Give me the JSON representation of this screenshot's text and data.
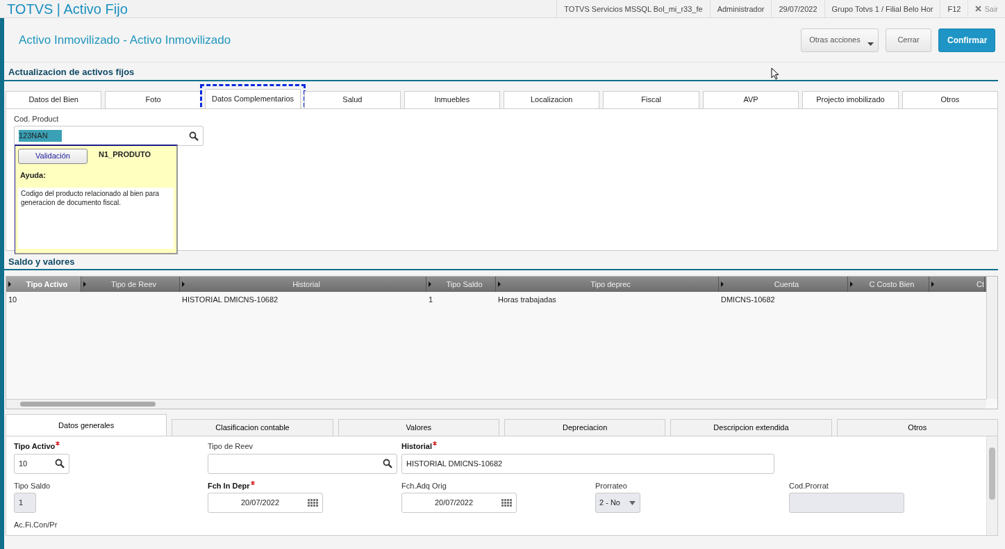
{
  "app_bar": {
    "title": "TOTVS | Activo Fijo",
    "items": [
      "TOTVS Servicios MSSQL Bol_mi_r33_fe",
      "Administrador",
      "29/07/2022",
      "Grupo Totvs 1 / Filial Belo Hor",
      "F12"
    ],
    "exit": "Sair"
  },
  "header": {
    "title": "Activo Inmovilizado - Activo Inmovilizado",
    "buttons": [
      {
        "label": "Otras acciones",
        "kind": "menu"
      },
      {
        "label": "Cerrar",
        "kind": "plain"
      },
      {
        "label": "Confirmar",
        "kind": "primary"
      }
    ]
  },
  "section_title": "Actualizacion de activos fijos",
  "tabs": [
    {
      "label": "Datos del Bien",
      "selected": false
    },
    {
      "label": "Foto",
      "selected": false
    },
    {
      "label": "Datos Complementarios",
      "selected": true
    },
    {
      "label": "Salud",
      "selected": false
    },
    {
      "label": "Inmuebles",
      "selected": false
    },
    {
      "label": "Localizacion",
      "selected": false
    },
    {
      "label": "Fiscal",
      "selected": false
    },
    {
      "label": "AVP",
      "selected": false
    },
    {
      "label": "Projecto imobilizado",
      "selected": false
    },
    {
      "label": "Otros",
      "selected": false
    }
  ],
  "field": {
    "label": "Cod. Product",
    "value": "123NAN"
  },
  "help_popup": {
    "button": "Validación",
    "field_name": "N1_PRODUTO",
    "heading": "Ayuda:",
    "text": "Codigo del producto relacionado al bien para generacion de documento fiscal."
  },
  "section2_title": "Saldo y valores",
  "grid": {
    "columns": [
      {
        "label": "Tipo Activo",
        "selected": true
      },
      {
        "label": "Tipo de Reev",
        "selected": false
      },
      {
        "label": "Historial",
        "selected": false
      },
      {
        "label": "Tipo Saldo",
        "selected": false
      },
      {
        "label": "Tipo deprec",
        "selected": false
      },
      {
        "label": "Cuenta",
        "selected": false
      },
      {
        "label": "C Costo Bien",
        "selected": false
      },
      {
        "label": "Ct",
        "selected": false
      }
    ],
    "rows": [
      {
        "cells": [
          "10",
          null,
          "HISTORIAL DMICNS-10682",
          "1",
          "Horas trabajadas",
          "DMICNS-10682",
          null,
          null
        ]
      }
    ]
  },
  "bottom_tabs": [
    {
      "label": "Datos generales",
      "selected": true
    },
    {
      "label": "Clasificacion contable",
      "selected": false
    },
    {
      "label": "Valores",
      "selected": false
    },
    {
      "label": "Depreciacion",
      "selected": false
    },
    {
      "label": "Descripcion extendida",
      "selected": false
    },
    {
      "label": "Otros",
      "selected": false
    }
  ],
  "form": {
    "rows": [
      [
        {
          "label": "Tipo Activo",
          "required": true,
          "kind": "lookup",
          "value": "10"
        },
        {
          "label": "Tipo de Reev",
          "required": false,
          "kind": "lookup"
        },
        {
          "label": "Historial",
          "required": true,
          "kind": "text",
          "value": "HISTORIAL DMICNS-10682"
        }
      ],
      [
        {
          "label": "Tipo Saldo",
          "required": false,
          "kind": "readonly",
          "value": "1"
        },
        {
          "label": "Fch In Depr",
          "required": true,
          "kind": "date",
          "value": "20/07/2022"
        },
        {
          "label": "Fch.Adq Orig",
          "required": false,
          "kind": "date",
          "value": "20/07/2022"
        },
        {
          "label": "Prorrateo",
          "required": false,
          "kind": "select",
          "value": "2 - No"
        },
        {
          "label": "Cod.Prorrat",
          "required": false,
          "kind": "readonly"
        }
      ],
      [
        {
          "label": "Ac.Fi.Con/Pr",
          "required": false,
          "kind": "label"
        }
      ]
    ]
  }
}
